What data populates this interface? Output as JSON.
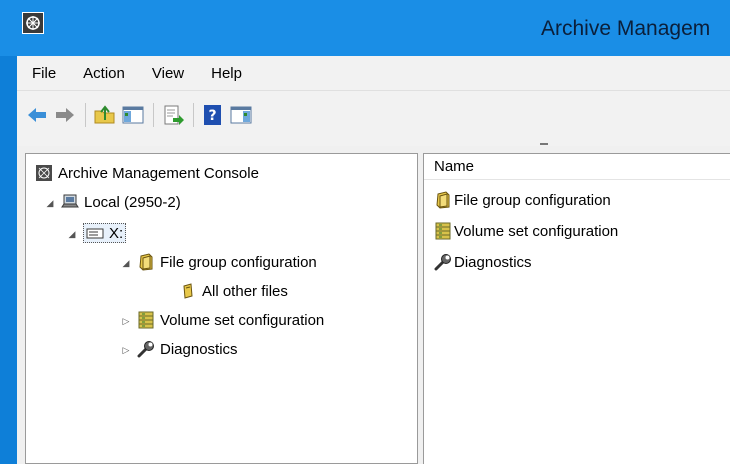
{
  "window": {
    "title": "Archive Managem"
  },
  "menu": {
    "items": [
      "File",
      "Action",
      "View",
      "Help"
    ]
  },
  "toolbar": {
    "buttons": [
      "back-icon",
      "forward-icon",
      "up-folder-icon",
      "show-hide-tree-icon",
      "export-list-icon",
      "help-icon",
      "show-hide-action-pane-icon"
    ]
  },
  "tree": {
    "root": "Archive Management Console",
    "local": "Local (2950-2)",
    "drive": "X:",
    "file_group": "File group configuration",
    "all_other_files": "All other files",
    "volume_set": "Volume set configuration",
    "diagnostics": "Diagnostics"
  },
  "list": {
    "column_name": "Name",
    "rows": [
      "File group configuration",
      "Volume set configuration",
      "Diagnostics"
    ]
  },
  "colors": {
    "titlebar": "#1a8ee6",
    "folder": "#e8c84a",
    "volume": "#d8c24a"
  }
}
